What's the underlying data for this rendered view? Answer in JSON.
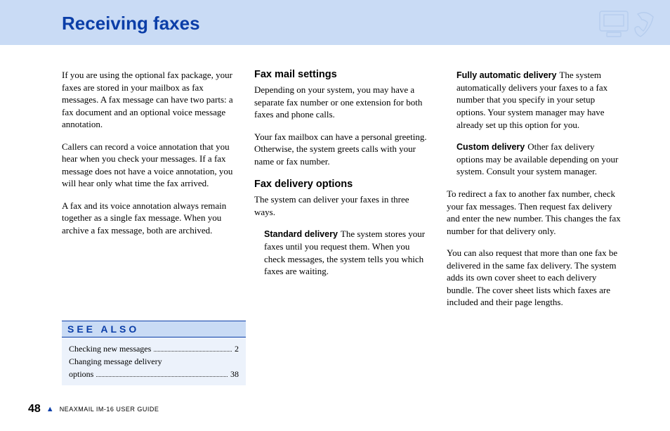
{
  "header": {
    "title": "Receiving faxes"
  },
  "col1": {
    "p1": "If you are using the optional fax package, your faxes are stored in your mailbox as fax messages. A fax message can have two parts: a fax document and an optional voice message annotation.",
    "p2": "Callers can record a voice annotation that you hear when you check your messages. If a fax message does not have a voice annotation, you will hear only what time the fax arrived.",
    "p3": "A fax and its voice annotation always remain together as a single fax message. When you archive a fax message, both are archived."
  },
  "col2": {
    "h1": "Fax mail settings",
    "p1": "Depending on your system, you may have a separate fax number or one extension for both faxes and phone calls.",
    "p2": "Your fax mailbox can have a personal greeting. Otherwise, the system greets calls with your name or fax number.",
    "h2": "Fax delivery options",
    "p3": "The system can deliver your faxes in three ways.",
    "std_label": "Standard delivery",
    "std_body": "The system stores your faxes until you request them. When you check messages, the system tells you which faxes are waiting."
  },
  "col3": {
    "auto_label": "Fully automatic delivery",
    "auto_body": "The system automatically delivers your faxes to a fax number that you specify in your setup options. Your system manager may have already set up this option for you.",
    "cust_label": "Custom delivery",
    "cust_body": "Other fax delivery options may be available depending on your system. Consult your system manager.",
    "p1": "To redirect a fax to another fax number, check your fax messages. Then request fax delivery and enter the new number. This changes the fax number for that delivery only.",
    "p2": "You can also request that more than one fax be delivered in the same fax delivery. The system adds its own cover sheet to each delivery bundle. The cover sheet lists which faxes are included and their page lengths."
  },
  "seealso": {
    "heading": "SEE ALSO",
    "items": [
      {
        "label": "Checking new messages",
        "page": "2"
      },
      {
        "label": "Changing message delivery options",
        "page": "38"
      }
    ]
  },
  "footer": {
    "page": "48",
    "guide": "NEAXMAIL IM-16 USER GUIDE"
  }
}
